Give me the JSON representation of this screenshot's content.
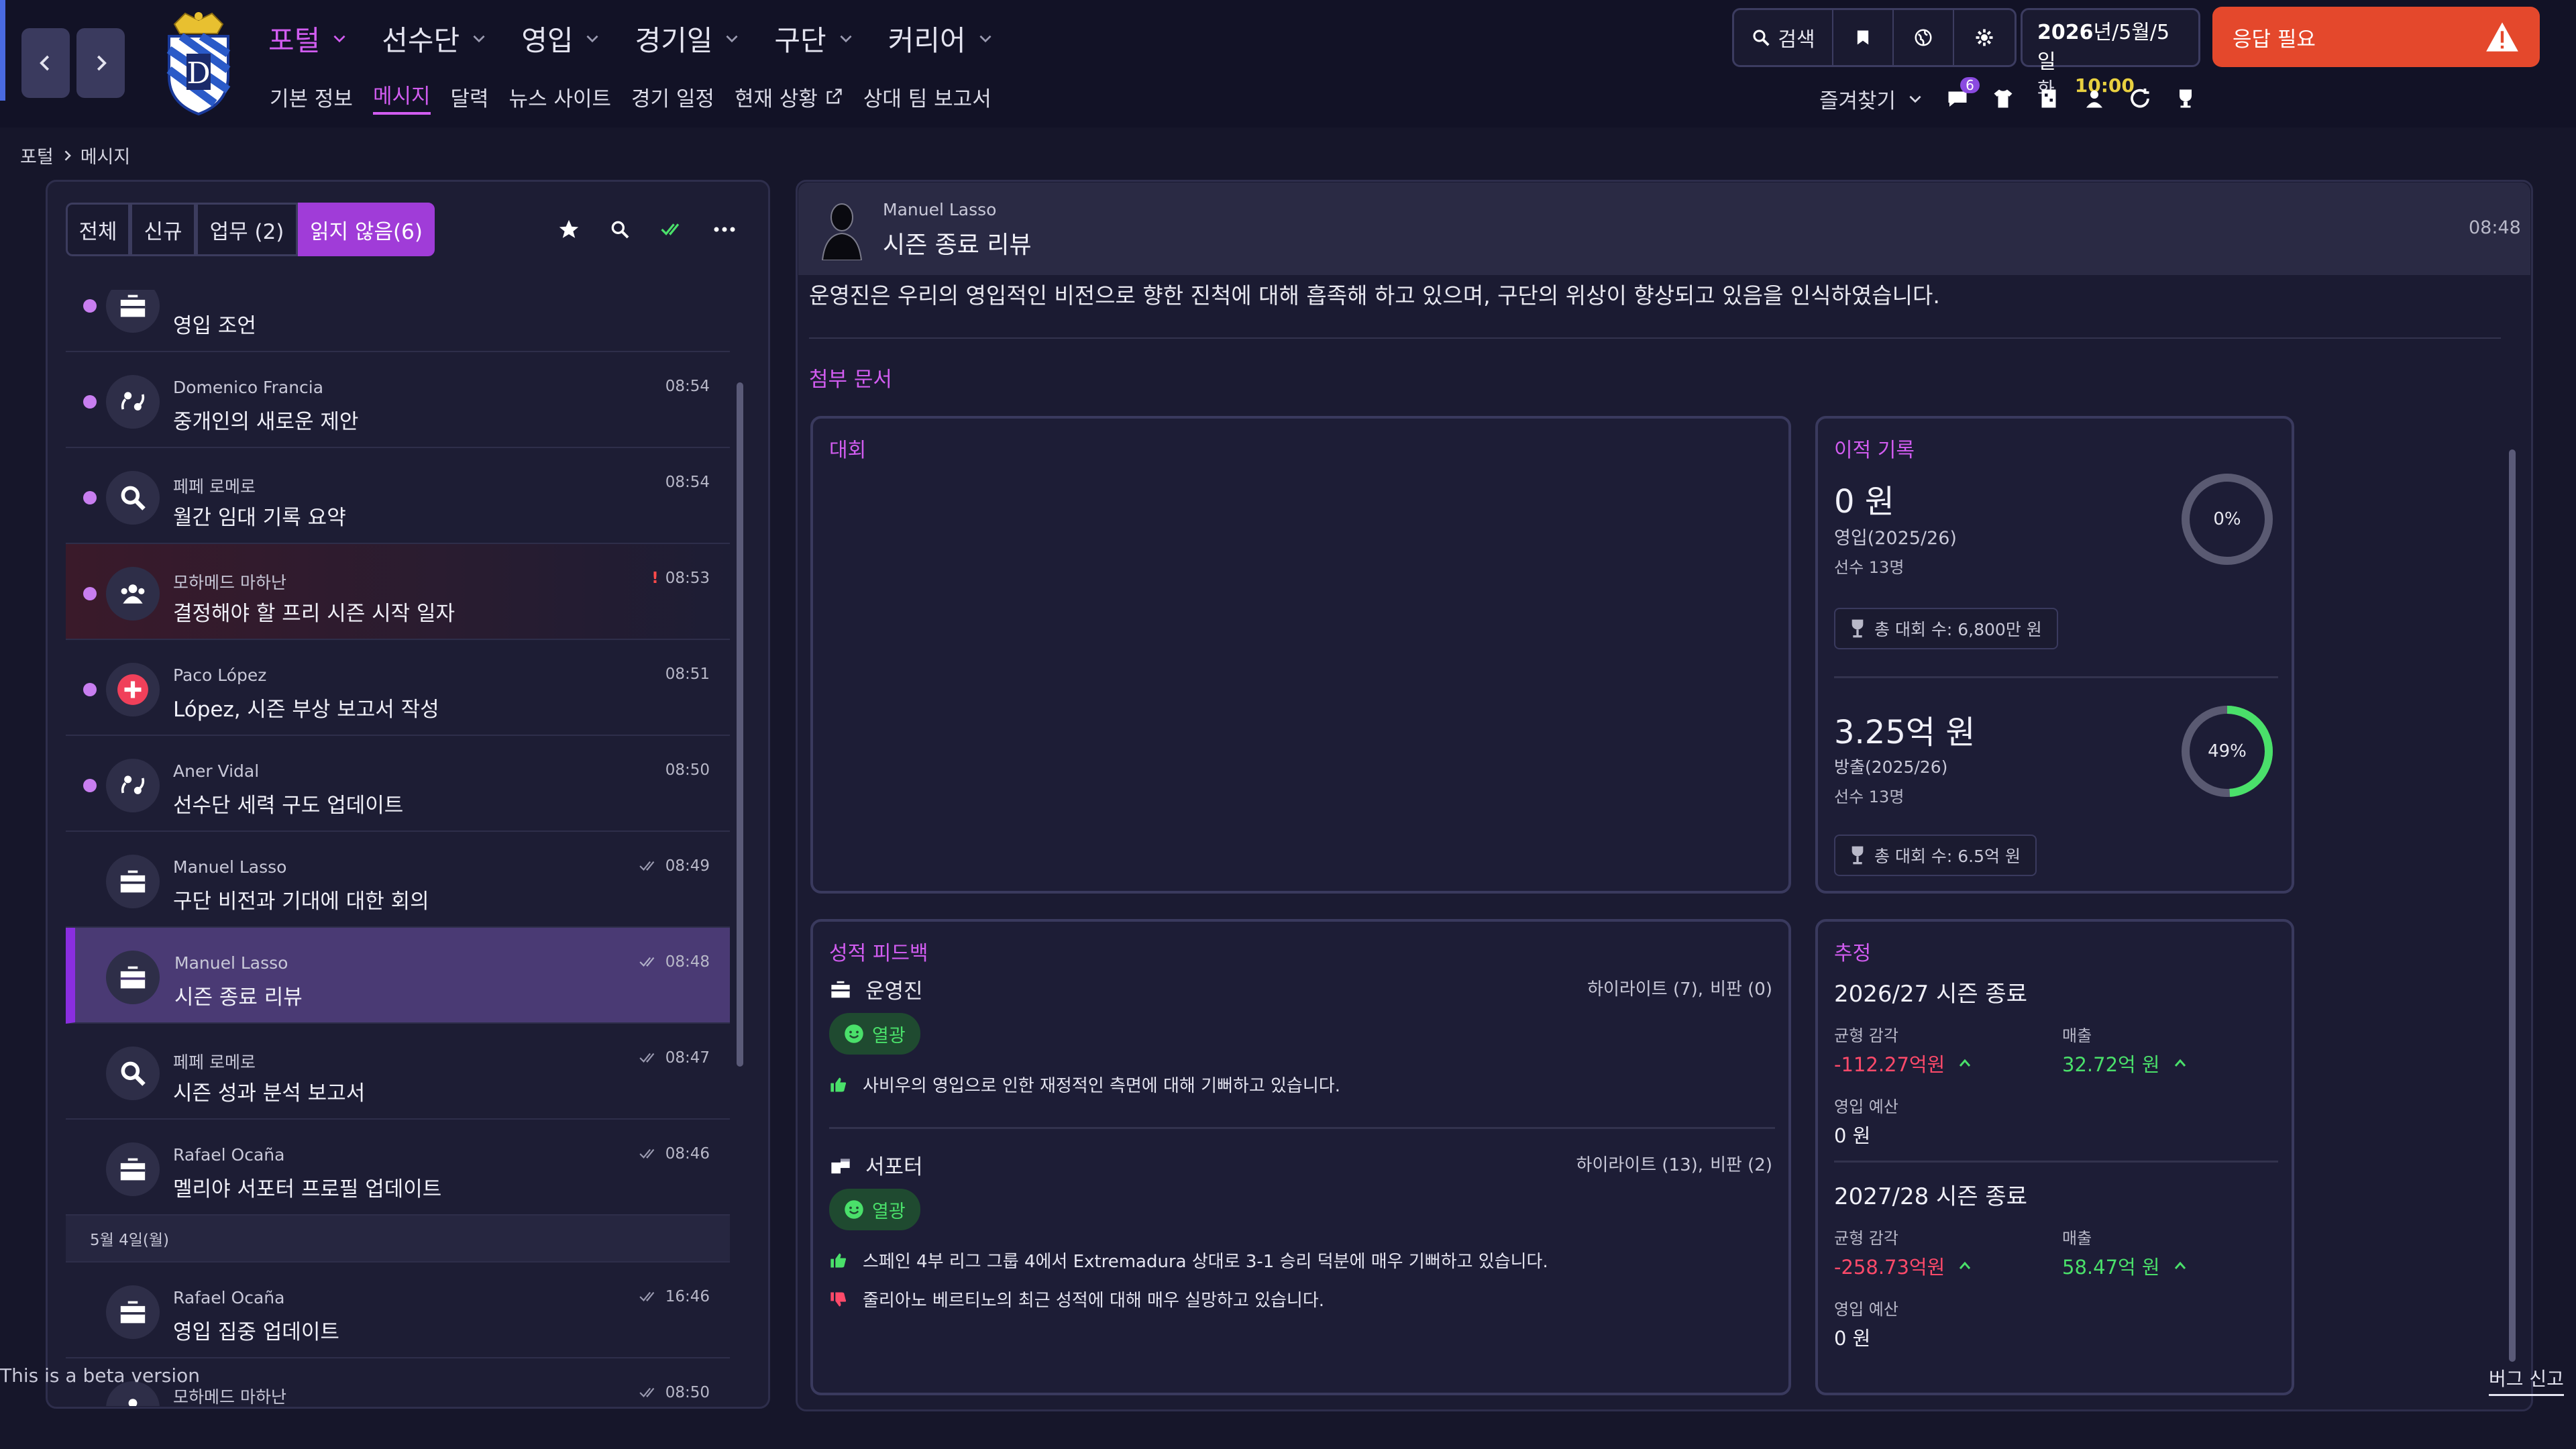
{
  "topnav": {
    "items": [
      {
        "label": "포털",
        "active": true
      },
      {
        "label": "선수단"
      },
      {
        "label": "영입"
      },
      {
        "label": "경기일"
      },
      {
        "label": "구단"
      },
      {
        "label": "커리어"
      }
    ],
    "subnav": [
      "기본 정보",
      "메시지",
      "달력",
      "뉴스 사이트",
      "경기 일정",
      "현재 상황",
      "상대 팀 보고서"
    ],
    "search_label": "검색",
    "date": {
      "prefix": "2026",
      "rest": "년/5월/5일",
      "weekday": "화",
      "time": "10:00"
    },
    "respond_label": "응답 필요",
    "favorites_label": "즐겨찾기",
    "notification_count": "6"
  },
  "breadcrumb": [
    "포털",
    "메시지"
  ],
  "filters": [
    "전체",
    "신규",
    "업무 (2)",
    "읽지 않음(6)"
  ],
  "messages": [
    {
      "sender": "",
      "subject": "영입 조언",
      "time": "",
      "unread": true,
      "icon": "briefcase-icon"
    },
    {
      "sender": "Domenico Francia",
      "subject": "중개인의 새로운 제안",
      "time": "08:54",
      "unread": true,
      "icon": "agent-icon"
    },
    {
      "sender": "페페 로메로",
      "subject": "월간 임대 기록 요약",
      "time": "08:54",
      "unread": true,
      "icon": "magnifier-icon"
    },
    {
      "sender": "모하메드 마하난",
      "subject": "결정해야 할 프리 시즌 시작 일자",
      "time": "08:53",
      "unread": true,
      "urgent": true,
      "icon": "group-icon"
    },
    {
      "sender": "Paco López",
      "subject": "López, 시즌 부상 보고서 작성",
      "time": "08:51",
      "unread": true,
      "icon": "medical-icon"
    },
    {
      "sender": "Aner Vidal",
      "subject": "선수단 세력 구도 업데이트",
      "time": "08:50",
      "unread": true,
      "icon": "agent-icon"
    },
    {
      "sender": "Manuel Lasso",
      "subject": "구단 비전과 기대에 대한 회의",
      "time": "08:49",
      "read": true,
      "icon": "briefcase-icon"
    },
    {
      "sender": "Manuel Lasso",
      "subject": "시즌 종료 리뷰",
      "time": "08:48",
      "read": true,
      "selected": true,
      "icon": "briefcase-icon"
    },
    {
      "sender": "페페 로메로",
      "subject": "시즌 성과 분석 보고서",
      "time": "08:47",
      "read": true,
      "icon": "magnifier-icon"
    },
    {
      "sender": "Rafael Ocaña",
      "subject": "멜리야 서포터 프로필 업데이트",
      "time": "08:46",
      "read": true,
      "icon": "briefcase-icon"
    }
  ],
  "day_header": "5월 4일(월)",
  "messages_day2": [
    {
      "sender": "Rafael Ocaña",
      "subject": "영입 집중 업데이트",
      "time": "16:46",
      "read": true,
      "icon": "briefcase-icon"
    },
    {
      "sender": "모하메드 마하난",
      "subject": "",
      "time": "08:50",
      "read": true,
      "icon": "group-icon"
    }
  ],
  "detail": {
    "sender": "Manuel Lasso",
    "subject": "시즌 종료 리뷰",
    "time": "08:48",
    "body": "운영진은 우리의 영입적인 비전으로 향한 진척에 대해 흡족해 하고 있으며, 구단의 위상이 향상되고 있음을 인식하였습니다.",
    "attachments_title": "첨부 문서",
    "competition_title": "대회",
    "transfer": {
      "title": "이적 기록",
      "in_value": "0 원",
      "in_label": "영입(2025/26)",
      "in_players": "선수 13명",
      "in_percent": 0,
      "in_percent_label": "0%",
      "in_total": "총 대회 수: 6,800만 원",
      "out_value": "3.25억 원",
      "out_label": "방출(2025/26)",
      "out_players": "선수 13명",
      "out_percent": 49,
      "out_percent_label": "49%",
      "out_total": "총 대회 수: 6.5억 원"
    },
    "feedback": {
      "title": "성적 피드백",
      "groups": [
        {
          "name": "운영진",
          "highlights": "하이라이트 (7),",
          "criticism": "비판 (0)",
          "badge": "열광",
          "items": [
            {
              "type": "positive",
              "text": "사비우의 영입으로 인한 재정적인 측면에 대해 기뻐하고 있습니다."
            }
          ]
        },
        {
          "name": "서포터",
          "highlights": "하이라이트 (13),",
          "criticism": "비판 (2)",
          "badge": "열광",
          "items": [
            {
              "type": "positive",
              "text": "스페인 4부 리그 그룹 4에서 Extremadura 상대로 3-1 승리 덕분에 매우 기뻐하고 있습니다."
            },
            {
              "type": "negative",
              "text": "줄리아노 베르티노의 최근 성적에 대해 매우 실망하고 있습니다."
            }
          ]
        }
      ]
    },
    "estimate": {
      "title": "추정",
      "seasons": [
        {
          "name": "2026/27 시즌 종료",
          "balance_label": "균형 감각",
          "balance": "-112.27억원",
          "revenue_label": "매출",
          "revenue": "32.72억 원",
          "budget_label": "영입 예산",
          "budget": "0 원"
        },
        {
          "name": "2027/28 시즌 종료",
          "balance_label": "균형 감각",
          "balance": "-258.73억원",
          "revenue_label": "매출",
          "revenue": "58.47억 원",
          "budget_label": "영입 예산",
          "budget": "0 원"
        }
      ]
    }
  },
  "footer": {
    "beta": "This is a beta version",
    "bug": "버그 신고"
  },
  "colors": {
    "accent": "#d15cf0",
    "selected": "#8a2ee0",
    "respond": "#e4482c",
    "positive": "#4ae06a",
    "negative": "#ff4a6a"
  }
}
